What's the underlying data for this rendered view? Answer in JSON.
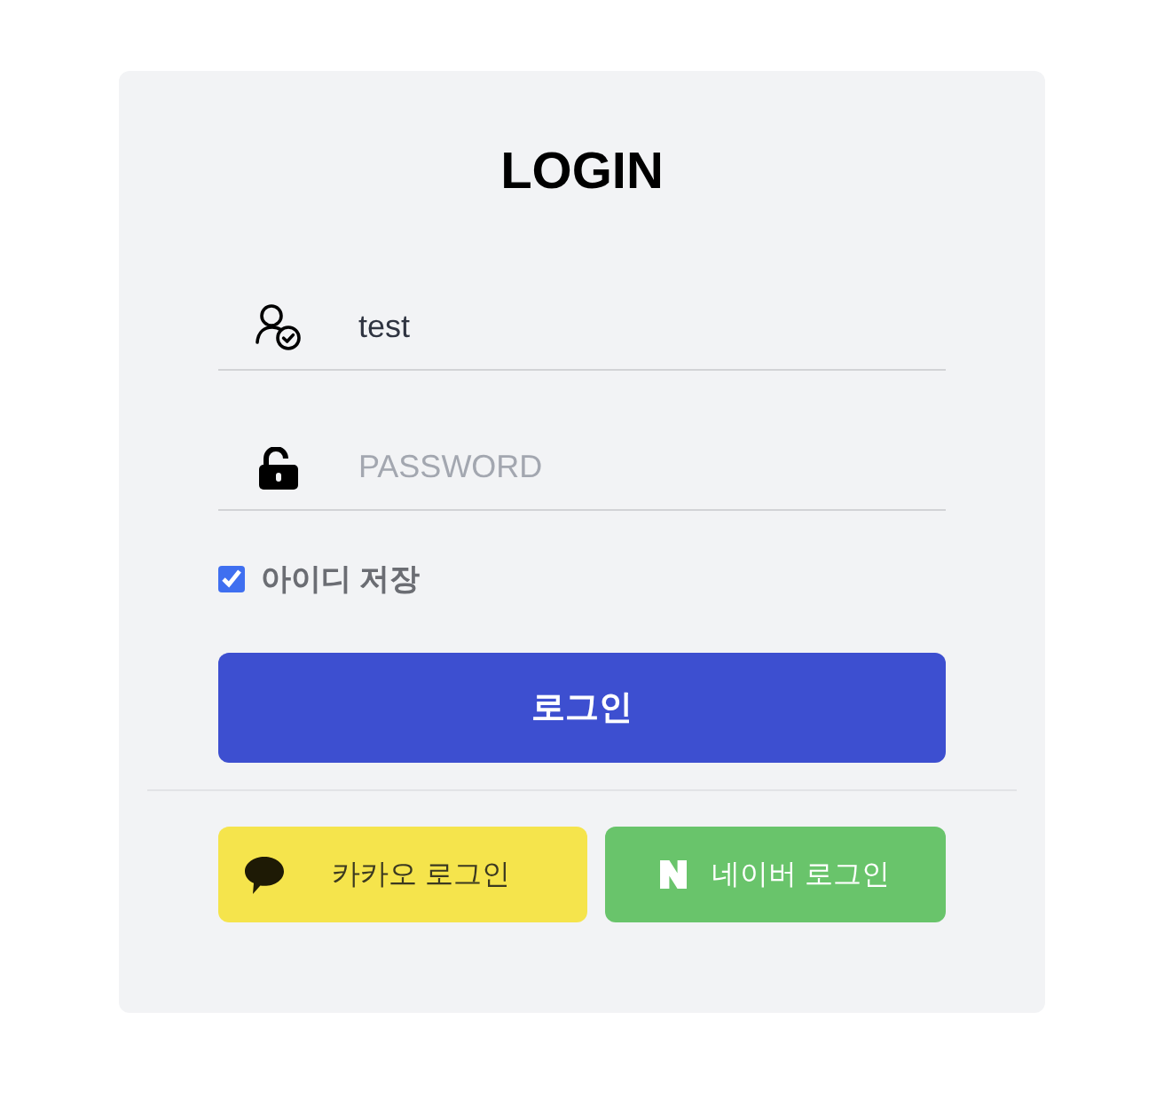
{
  "title": "LOGIN",
  "fields": [
    {
      "kind": "user",
      "value": "test"
    },
    {
      "kind": "password",
      "placeholder": "PASSWORD"
    }
  ],
  "remember": {
    "label": "아이디 저장",
    "checked": true
  },
  "login_button": {
    "label": "로그인"
  },
  "social_buttons": [
    {
      "kind": "kakao",
      "label": "카카오 로그인"
    },
    {
      "kind": "naver",
      "label": "네이버 로그인"
    }
  ]
}
